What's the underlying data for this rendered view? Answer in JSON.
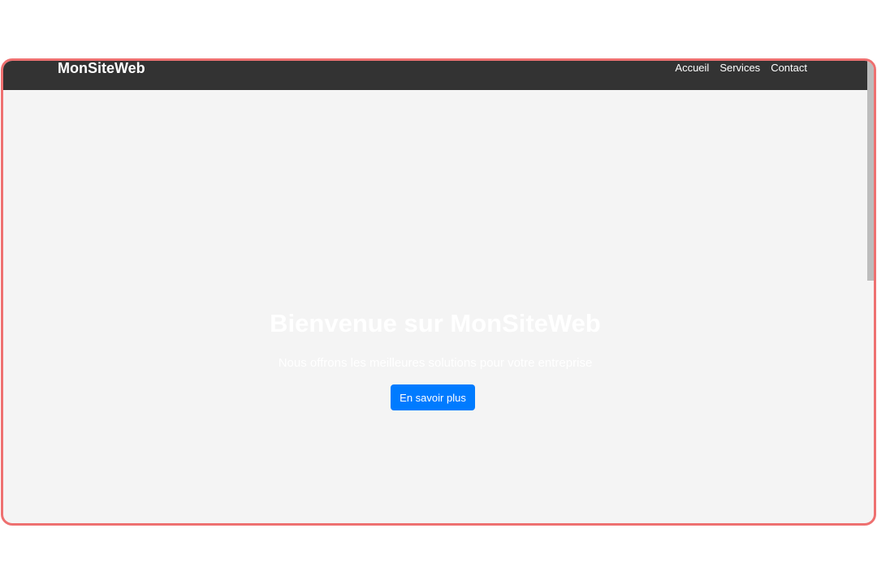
{
  "header": {
    "brand": "MonSiteWeb",
    "nav": [
      {
        "label": "Accueil"
      },
      {
        "label": "Services"
      },
      {
        "label": "Contact"
      }
    ]
  },
  "hero": {
    "title": "Bienvenue sur MonSiteWeb",
    "subtitle": "Nous offrons les meilleures solutions pour votre entreprise",
    "cta_label": "En savoir plus"
  },
  "colors": {
    "navbar_bg": "#333333",
    "page_bg": "#f4f4f4",
    "accent": "#007bff",
    "frame_border": "#ee7070"
  }
}
